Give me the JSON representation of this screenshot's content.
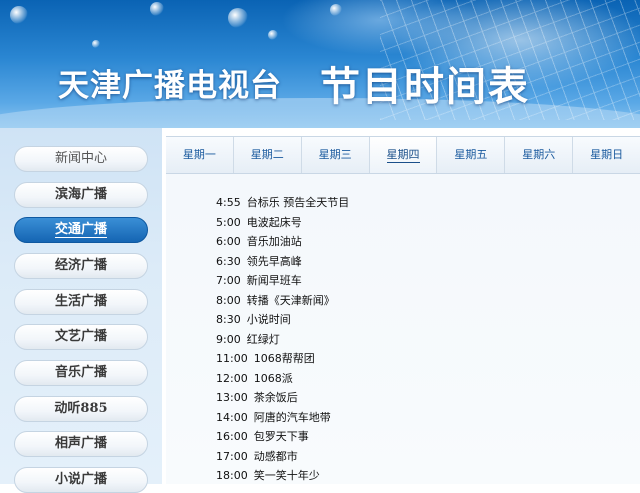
{
  "banner": {
    "station_name": "天津广播电视台",
    "page_title": "节目时间表"
  },
  "sidebar": {
    "items": [
      {
        "label": "新闻中心",
        "active": false
      },
      {
        "label": "滨海广播",
        "active": false
      },
      {
        "label": "交通广播",
        "active": true
      },
      {
        "label": "经济广播",
        "active": false
      },
      {
        "label": "生活广播",
        "active": false
      },
      {
        "label": "文艺广播",
        "active": false
      },
      {
        "label": "音乐广播",
        "active": false
      },
      {
        "label": "动听885",
        "active": false
      },
      {
        "label": "相声广播",
        "active": false
      },
      {
        "label": "小说广播",
        "active": false
      }
    ]
  },
  "tabs": [
    {
      "label": "星期一",
      "active": false
    },
    {
      "label": "星期二",
      "active": false
    },
    {
      "label": "星期三",
      "active": false
    },
    {
      "label": "星期四",
      "active": true
    },
    {
      "label": "星期五",
      "active": false
    },
    {
      "label": "星期六",
      "active": false
    },
    {
      "label": "星期日",
      "active": false
    }
  ],
  "schedule": [
    {
      "time": "4:55",
      "program": "台标乐 预告全天节目"
    },
    {
      "time": "5:00",
      "program": "电波起床号"
    },
    {
      "time": "6:00",
      "program": "音乐加油站"
    },
    {
      "time": "6:30",
      "program": "领先早高峰"
    },
    {
      "time": "7:00",
      "program": "新闻早班车"
    },
    {
      "time": "8:00",
      "program": "转播《天津新闻》"
    },
    {
      "time": "8:30",
      "program": "小说时间"
    },
    {
      "time": "9:00",
      "program": "红绿灯"
    },
    {
      "time": "11:00",
      "program": "1068帮帮团"
    },
    {
      "time": "12:00",
      "program": "1068派"
    },
    {
      "time": "13:00",
      "program": "茶余饭后"
    },
    {
      "time": "14:00",
      "program": "阿唐的汽车地带"
    },
    {
      "time": "16:00",
      "program": "包罗天下事"
    },
    {
      "time": "17:00",
      "program": "动感都市"
    },
    {
      "time": "18:00",
      "program": "笑一笑十年少"
    }
  ]
}
